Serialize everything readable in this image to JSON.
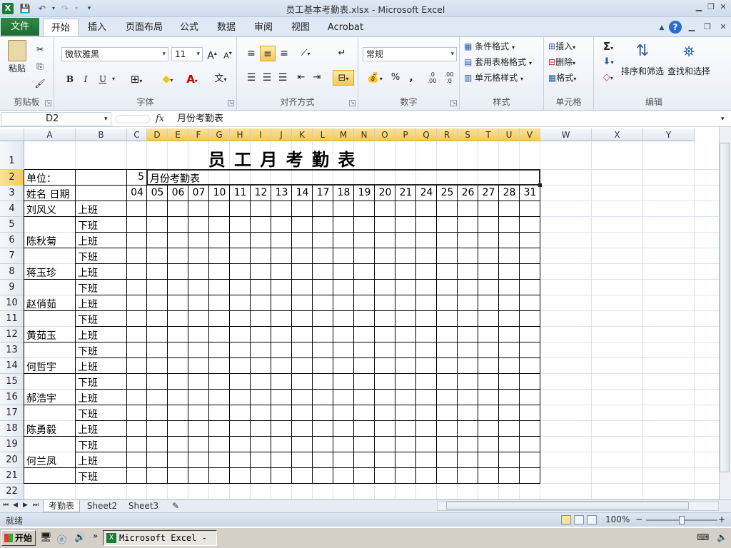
{
  "window": {
    "title": "员工基本考勤表.xlsx  -  Microsoft Excel"
  },
  "tabs": [
    "文件",
    "开始",
    "插入",
    "页面布局",
    "公式",
    "数据",
    "审阅",
    "视图",
    "Acrobat"
  ],
  "ribbon": {
    "clipboard": {
      "paste": "粘贴",
      "label": "剪贴板"
    },
    "font": {
      "name": "微软雅黑",
      "size": "11",
      "label": "字体",
      "bold": "B",
      "italic": "I",
      "underline": "U",
      "wen": "文"
    },
    "alignment": {
      "label": "对齐方式"
    },
    "number": {
      "format": "常规",
      "label": "数字",
      "percent": "%",
      "comma": ",",
      "inc_decimal": ".0\n.00",
      "dec_decimal": ".00\n.0"
    },
    "styles": {
      "conditional": "条件格式",
      "table": "套用表格格式",
      "cell": "单元格样式",
      "label": "样式"
    },
    "cells": {
      "insert": "插入",
      "delete": "删除",
      "format": "格式",
      "label": "单元格"
    },
    "editing": {
      "sort": "排序和筛选",
      "find": "查找和选择",
      "label": "编辑",
      "sigma": "Σ"
    }
  },
  "formula_bar": {
    "name_box": "D2",
    "fx": "fx",
    "value": "月份考勤表"
  },
  "sheet": {
    "columns": [
      "A",
      "B",
      "C",
      "D",
      "E",
      "F",
      "G",
      "H",
      "I",
      "J",
      "K",
      "L",
      "M",
      "N",
      "O",
      "P",
      "Q",
      "R",
      "S",
      "T",
      "U",
      "V",
      "W",
      "X",
      "Y"
    ],
    "rows": [
      "1",
      "2",
      "3",
      "4",
      "5",
      "6",
      "7",
      "8",
      "9",
      "10",
      "11",
      "12",
      "13",
      "14",
      "15",
      "16",
      "17",
      "18",
      "19",
      "20",
      "21",
      "22"
    ],
    "title": "员 工 月 考 勤 表",
    "unit_label": "单位：",
    "month_value": "5",
    "month_text": "月份考勤表",
    "header_name_date": "姓名  日期",
    "days": [
      "04",
      "05",
      "06",
      "07",
      "10",
      "11",
      "12",
      "13",
      "14",
      "17",
      "18",
      "19",
      "20",
      "21",
      "24",
      "25",
      "26",
      "27",
      "28",
      "31"
    ],
    "employees": [
      "刘风义",
      "陈秋菊",
      "蒋玉珍",
      "赵俏茹",
      "黄茹玉",
      "何哲宇",
      "郝浩宇",
      "陈勇毅",
      "何兰凤"
    ],
    "shift_on": "上班",
    "shift_off": "下班"
  },
  "sheet_tabs": [
    "考勤表",
    "Sheet2",
    "Sheet3"
  ],
  "status": {
    "text": "就绪",
    "zoom": "100%",
    "minus": "−",
    "plus": "+"
  },
  "taskbar": {
    "start": "开始",
    "excel": "Microsoft Excel - ..."
  }
}
